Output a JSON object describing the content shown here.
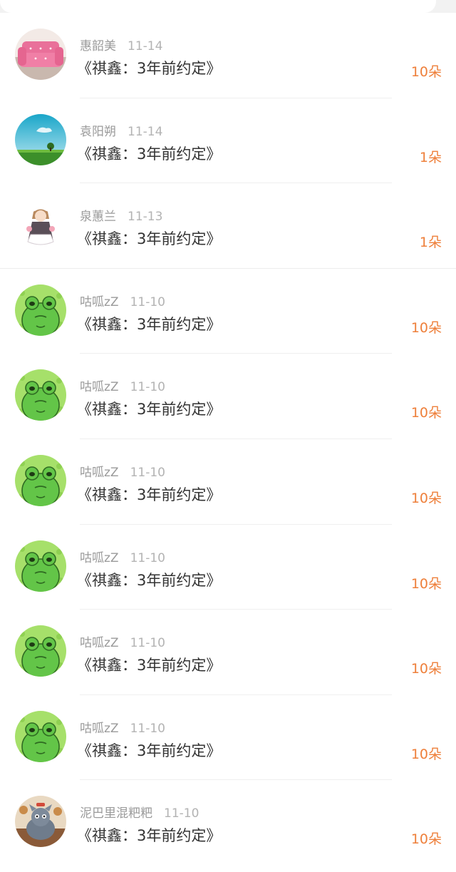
{
  "colors": {
    "amount": "#ee7f3a",
    "name": "#9a9a9a",
    "date": "#b3b3b3",
    "title": "#333333"
  },
  "gifts": [
    {
      "avatar_icon": "pink-sofa-avatar",
      "name": "惠韶美",
      "date": "11-14",
      "title": "《祺鑫：3年前约定》",
      "amount": "10朵"
    },
    {
      "avatar_icon": "sky-tree-avatar",
      "name": "袁阳朔",
      "date": "11-14",
      "title": "《祺鑫：3年前约定》",
      "amount": "1朵"
    },
    {
      "avatar_icon": "anime-girl-avatar",
      "name": "泉蕙兰",
      "date": "11-13",
      "title": "《祺鑫：3年前约定》",
      "amount": "1朵"
    },
    {
      "avatar_icon": "frog-avatar",
      "name": "咕呱zZ",
      "date": "11-10",
      "title": "《祺鑫：3年前约定》",
      "amount": "10朵"
    },
    {
      "avatar_icon": "frog-avatar",
      "name": "咕呱zZ",
      "date": "11-10",
      "title": "《祺鑫：3年前约定》",
      "amount": "10朵"
    },
    {
      "avatar_icon": "frog-avatar",
      "name": "咕呱zZ",
      "date": "11-10",
      "title": "《祺鑫：3年前约定》",
      "amount": "10朵"
    },
    {
      "avatar_icon": "frog-avatar",
      "name": "咕呱zZ",
      "date": "11-10",
      "title": "《祺鑫：3年前约定》",
      "amount": "10朵"
    },
    {
      "avatar_icon": "frog-avatar",
      "name": "咕呱zZ",
      "date": "11-10",
      "title": "《祺鑫：3年前约定》",
      "amount": "10朵"
    },
    {
      "avatar_icon": "frog-avatar",
      "name": "咕呱zZ",
      "date": "11-10",
      "title": "《祺鑫：3年前约定》",
      "amount": "10朵"
    },
    {
      "avatar_icon": "cartoon-cat-avatar",
      "name": "泥巴里混粑粑",
      "date": "11-10",
      "title": "《祺鑫：3年前约定》",
      "amount": "10朵"
    }
  ]
}
